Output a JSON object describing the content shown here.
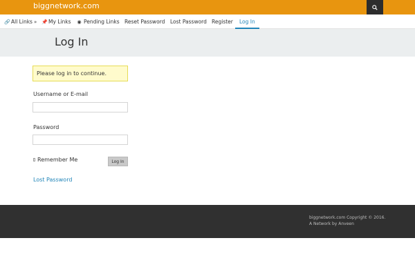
{
  "header": {
    "site_name": "biggnetwork.com",
    "search_icon": "search-icon"
  },
  "nav": {
    "items": [
      {
        "label": "All Links",
        "icon": "link-icon",
        "suffix": "»"
      },
      {
        "label": "My Links",
        "icon": "pin-icon"
      },
      {
        "label": "Pending Links",
        "icon": "eye-icon"
      },
      {
        "label": "Reset Password"
      },
      {
        "label": "Lost Password"
      },
      {
        "label": "Register"
      },
      {
        "label": "Log In",
        "active": true
      }
    ]
  },
  "page": {
    "title": "Log In"
  },
  "form": {
    "notice": "Please log in to continue.",
    "username_label": "Username or E-mail",
    "username_value": "",
    "password_label": "Password",
    "password_value": "",
    "remember_label": "Remember Me",
    "remember_checked": false,
    "login_button": "Log In",
    "lost_password_link": "Lost Password"
  },
  "footer": {
    "copyright_line1": "biggnetwork.com Copyright © 2016.",
    "copyright_line2": "A Network by Anveen"
  },
  "colors": {
    "topbar": "#e8950f",
    "accent": "#1f84b8",
    "footer": "#303030"
  }
}
